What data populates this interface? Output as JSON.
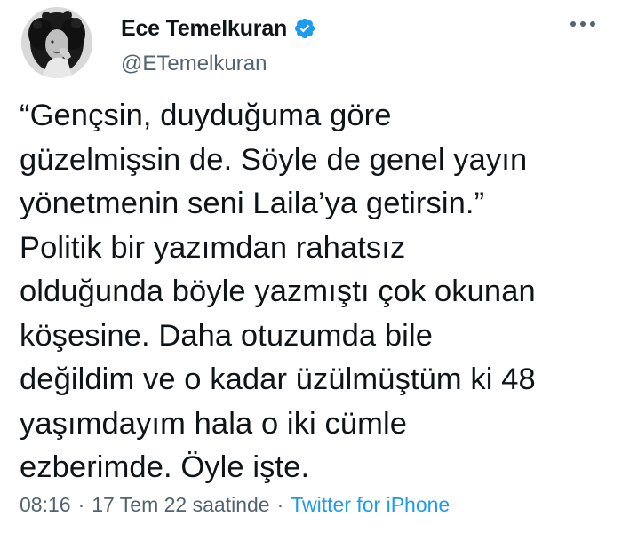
{
  "author": {
    "display_name": "Ece Temelkuran",
    "handle": "@ETemelkuran",
    "verified": true,
    "avatar_icon": "avatar-photo"
  },
  "tweet": {
    "text": "“Gençsin, duyduğuma göre\ngüzelmişsin de. Söyle de genel yayın\nyönetmenin seni Laila’ya getirsin.”\nPolitik bir yazımdan rahatsız\nolduğunda böyle yazmıştı çok okunan\nköşesine. Daha otuzumda bile\ndeğildim ve o kadar üzülmüştüm ki 48\nyaşımdayım hala o iki cümle\nezberimde. Öyle işte."
  },
  "meta": {
    "time": "08:16",
    "separator": "·",
    "date": "17 Tem 22 saatinde",
    "source": "Twitter for iPhone"
  },
  "colors": {
    "text": "#0f1419",
    "secondary": "#536471",
    "accent": "#1d9bf0"
  },
  "icons": {
    "verified": "verified-badge-icon",
    "more": "more-options-icon"
  }
}
